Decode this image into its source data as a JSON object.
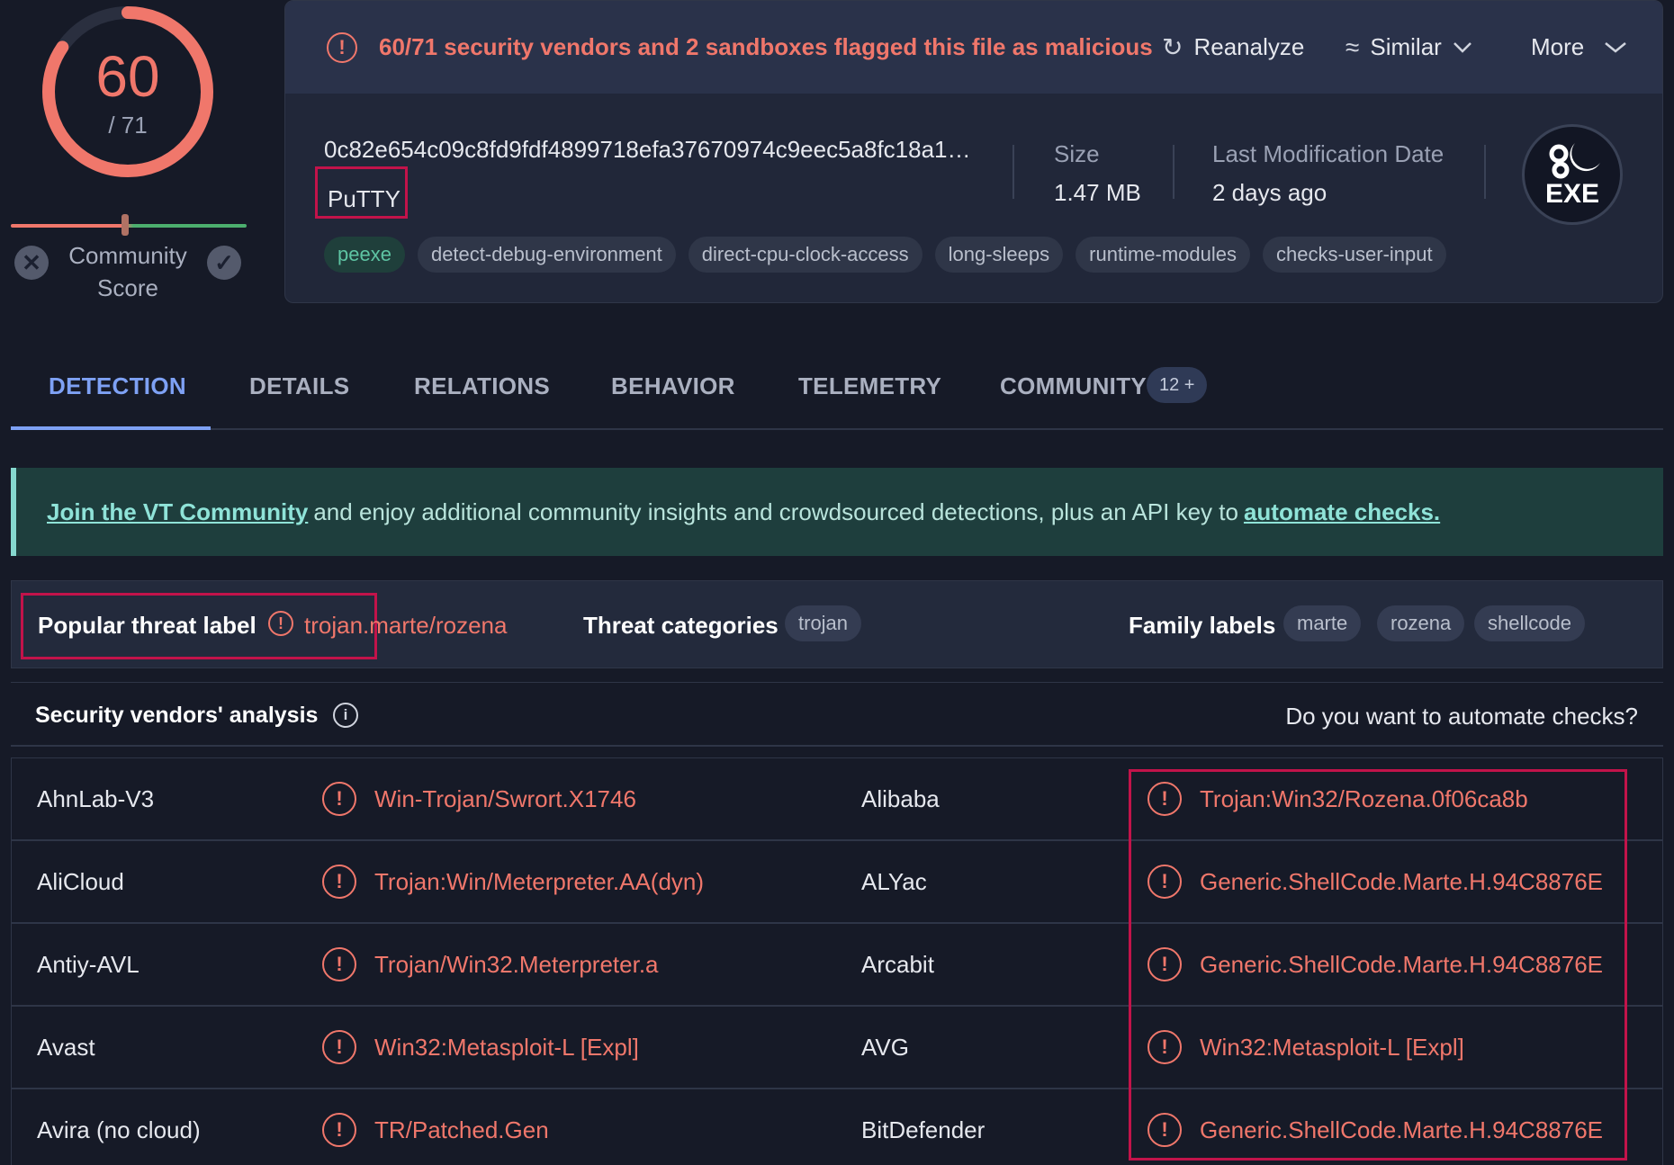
{
  "score": {
    "detected": "60",
    "total": "/ 71",
    "ratio": 0.845,
    "ring_color": "#f0776b"
  },
  "community": {
    "label": "Community Score",
    "x_icon": "x-icon",
    "check_icon": "check-icon"
  },
  "alert": {
    "message": "60/71 security vendors and 2 sandboxes flagged this file as malicious",
    "reanalyze": "Reanalyze",
    "similar": "Similar",
    "more": "More"
  },
  "file": {
    "hash": "0c82e654c09c8fd9fdf4899718efa37670974c9eec5a8fc18a16…",
    "name": "PuTTY",
    "size_label": "Size",
    "size_value": "1.47 MB",
    "date_label": "Last Modification Date",
    "date_value": "2 days ago",
    "type_badge": "EXE",
    "tags": [
      "peexe",
      "detect-debug-environment",
      "direct-cpu-clock-access",
      "long-sleeps",
      "runtime-modules",
      "checks-user-input"
    ]
  },
  "tabs": [
    "DETECTION",
    "DETAILS",
    "RELATIONS",
    "BEHAVIOR",
    "TELEMETRY",
    "COMMUNITY"
  ],
  "tab_badge": "12 +",
  "banner": {
    "link1": "Join the VT Community",
    "text": "and enjoy additional community insights and crowdsourced detections, plus an API key to",
    "link2": "automate checks."
  },
  "threat": {
    "popular_label": "Popular threat label",
    "popular_value": "trojan.marte/rozena",
    "categories_label": "Threat categories",
    "categories": [
      "trojan"
    ],
    "family_label": "Family labels",
    "families": [
      "marte",
      "rozena",
      "shellcode"
    ]
  },
  "analysis": {
    "title": "Security vendors' analysis",
    "automate": "Do you want to automate checks?"
  },
  "vendors": [
    {
      "v1": "AhnLab-V3",
      "r1": "Win-Trojan/Swrort.X1746",
      "v2": "Alibaba",
      "r2": "Trojan:Win32/Rozena.0f06ca8b"
    },
    {
      "v1": "AliCloud",
      "r1": "Trojan:Win/Meterpreter.AA(dyn)",
      "v2": "ALYac",
      "r2": "Generic.ShellCode.Marte.H.94C8876E"
    },
    {
      "v1": "Antiy-AVL",
      "r1": "Trojan/Win32.Meterpreter.a",
      "v2": "Arcabit",
      "r2": "Generic.ShellCode.Marte.H.94C8876E"
    },
    {
      "v1": "Avast",
      "r1": "Win32:Metasploit-L [Expl]",
      "v2": "AVG",
      "r2": "Win32:Metasploit-L [Expl]"
    },
    {
      "v1": "Avira (no cloud)",
      "r1": "TR/Patched.Gen",
      "v2": "BitDefender",
      "r2": "Generic.ShellCode.Marte.H.94C8876E"
    }
  ]
}
